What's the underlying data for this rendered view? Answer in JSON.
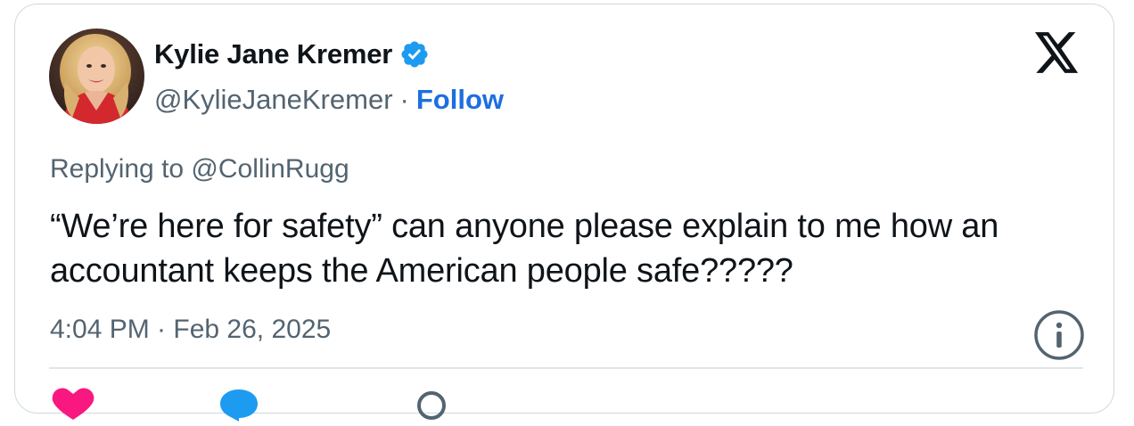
{
  "author": {
    "display_name": "Kylie Jane Kremer",
    "handle": "@KylieJaneKremer",
    "separator": "·",
    "follow_label": "Follow",
    "verified_icon": "verified-badge-icon"
  },
  "reply": {
    "text": "Replying to @CollinRugg"
  },
  "tweet": {
    "text": "“We’re here for safety” can anyone please explain to me how an accountant keeps the American people safe?????",
    "timestamp": "4:04 PM · Feb 26, 2025"
  },
  "icons": {
    "brand": "x-logo-icon",
    "info": "info-icon",
    "like": "heart-icon",
    "reply": "reply-bubble-icon",
    "share": "link-icon"
  },
  "colors": {
    "text_primary": "#0f1419",
    "text_secondary": "#536471",
    "follow_blue": "#1d6fe0",
    "verified_blue": "#1d9bf0",
    "like_pink": "#f91880",
    "border": "#cfd9de"
  }
}
